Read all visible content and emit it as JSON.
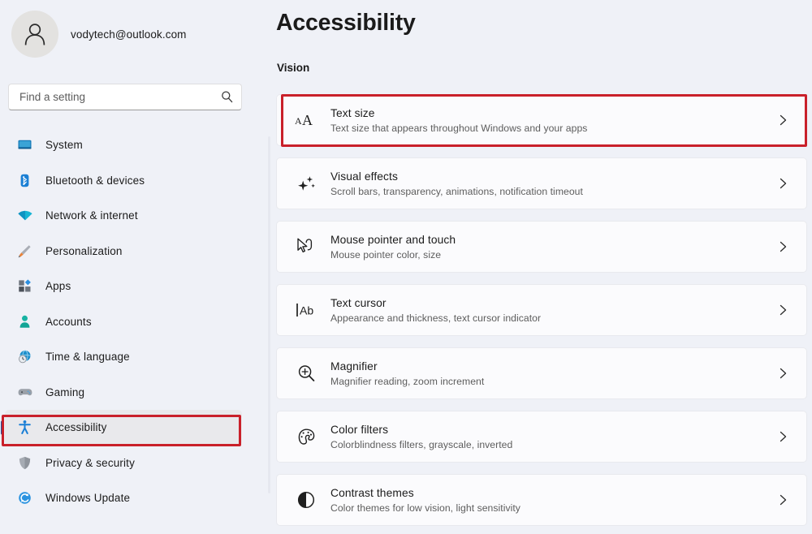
{
  "account": {
    "email": "vodytech@outlook.com",
    "avatar_icon": "person-avatar-icon"
  },
  "search": {
    "placeholder": "Find a setting",
    "value": "",
    "icon": "search-icon"
  },
  "sidebar": {
    "items": [
      {
        "label": "System",
        "icon": "monitor-icon",
        "selected": false
      },
      {
        "label": "Bluetooth & devices",
        "icon": "bluetooth-icon",
        "selected": false
      },
      {
        "label": "Network & internet",
        "icon": "wifi-icon",
        "selected": false
      },
      {
        "label": "Personalization",
        "icon": "paintbrush-icon",
        "selected": false
      },
      {
        "label": "Apps",
        "icon": "apps-grid-icon",
        "selected": false
      },
      {
        "label": "Accounts",
        "icon": "person-icon",
        "selected": false
      },
      {
        "label": "Time & language",
        "icon": "globe-clock-icon",
        "selected": false
      },
      {
        "label": "Gaming",
        "icon": "gamepad-icon",
        "selected": false
      },
      {
        "label": "Accessibility",
        "icon": "accessibility-person-icon",
        "selected": true
      },
      {
        "label": "Privacy & security",
        "icon": "shield-icon",
        "selected": false
      },
      {
        "label": "Windows Update",
        "icon": "update-refresh-icon",
        "selected": false
      }
    ]
  },
  "main": {
    "title": "Accessibility",
    "section_label": "Vision",
    "cards": [
      {
        "title": "Text size",
        "subtitle": "Text size that appears throughout Windows and your apps",
        "icon": "text-size-aa-icon",
        "chevron": "chevron-right-icon",
        "highlighted": true
      },
      {
        "title": "Visual effects",
        "subtitle": "Scroll bars, transparency, animations, notification timeout",
        "icon": "sparkles-icon",
        "chevron": "chevron-right-icon",
        "highlighted": false
      },
      {
        "title": "Mouse pointer and touch",
        "subtitle": "Mouse pointer color, size",
        "icon": "mouse-pointer-icon",
        "chevron": "chevron-right-icon",
        "highlighted": false
      },
      {
        "title": "Text cursor",
        "subtitle": "Appearance and thickness, text cursor indicator",
        "icon": "text-cursor-icon",
        "chevron": "chevron-right-icon",
        "highlighted": false
      },
      {
        "title": "Magnifier",
        "subtitle": "Magnifier reading, zoom increment",
        "icon": "magnifier-plus-icon",
        "chevron": "chevron-right-icon",
        "highlighted": false
      },
      {
        "title": "Color filters",
        "subtitle": "Colorblindness filters, grayscale, inverted",
        "icon": "color-palette-icon",
        "chevron": "chevron-right-icon",
        "highlighted": false
      },
      {
        "title": "Contrast themes",
        "subtitle": "Color themes for low vision, light sensitivity",
        "icon": "contrast-half-circle-icon",
        "chevron": "chevron-right-icon",
        "highlighted": false
      }
    ]
  },
  "annotations": {
    "color": "#c9202a",
    "targets": [
      "text-size-card",
      "sidebar-item-accessibility"
    ]
  },
  "colors": {
    "background": "#eff1f7",
    "card_surface": "#fbfbfd",
    "selected_nav": "#e9e9ec",
    "accent_indicator": "#1f4f9c",
    "annotation_red": "#c9202a",
    "text_primary": "#1b1b1b",
    "text_secondary": "#5d5d5d"
  }
}
